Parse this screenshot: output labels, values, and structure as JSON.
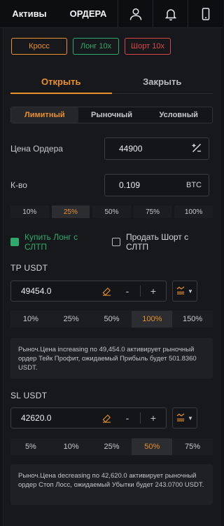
{
  "nav": {
    "assets": "Активы",
    "orders": "ОРДЕРА"
  },
  "chips": {
    "cross": "Кросс",
    "long": "Лонг 10x",
    "short": "Шорт 10x"
  },
  "tabs": {
    "open": "Открыть",
    "close": "Закрыть"
  },
  "order_types": {
    "limit": "Лимитный",
    "market": "Рыночный",
    "conditional": "Условный"
  },
  "price": {
    "label": "Цена Ордера",
    "value": "44900"
  },
  "qty": {
    "label": "К-во",
    "value": "0.109",
    "unit": "BTC"
  },
  "qty_percent": [
    "10%",
    "25%",
    "50%",
    "75%",
    "100%"
  ],
  "checkboxes": {
    "buy_long": "Купить Лонг с СЛТП",
    "sell_short": "Продать Шорт с СЛТП"
  },
  "tp": {
    "label": "TP  USDT",
    "value": "49454.0",
    "minus": "-",
    "plus": "+",
    "percents": [
      "10%",
      "25%",
      "50%",
      "100%",
      "150%"
    ],
    "note": "Рыноч.Цена increasing по 49,454.0 активирует рыночный ордер Тейк Профит, ожидаемый Прибыль будет 501.8360 USDT."
  },
  "sl": {
    "label": "SL  USDT",
    "value": "42620.0",
    "minus": "-",
    "plus": "+",
    "percents": [
      "5%",
      "10%",
      "25%",
      "50%",
      "75%"
    ],
    "note": "Рыноч.Цена decreasing по 42,620.0 активирует рыночный ордер Стоп Лосс, ожидаемый Убытки будет 243.0700 USDT."
  },
  "colors": {
    "accent": "#e8912d",
    "long": "#2fa86b",
    "short": "#d94848"
  }
}
